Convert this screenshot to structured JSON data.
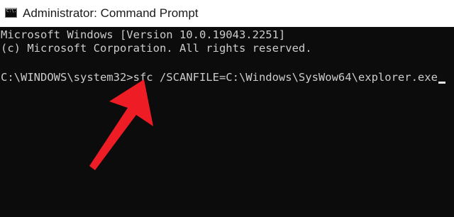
{
  "window": {
    "title": "Administrator: Command Prompt",
    "icon": "command-prompt-icon",
    "icon_glyph": "C:\\."
  },
  "console": {
    "lines": [
      "Microsoft Windows [Version 10.0.19043.2251]",
      "(c) Microsoft Corporation. All rights reserved.",
      "",
      "C:\\WINDOWS\\system32>sfc /SCANFILE=C:\\Windows\\SysWow64\\explorer.exe"
    ]
  },
  "annotation": {
    "icon": "red-arrow-icon",
    "color": "#ee1c25"
  }
}
